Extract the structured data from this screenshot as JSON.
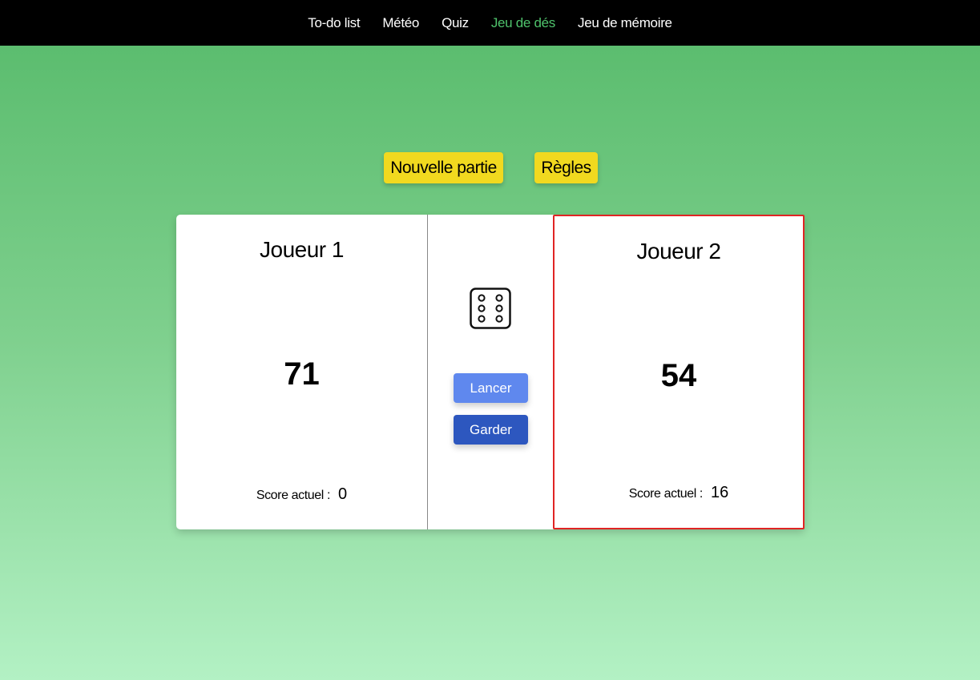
{
  "nav": {
    "items": [
      {
        "label": "To-do list",
        "active": false
      },
      {
        "label": "Météo",
        "active": false
      },
      {
        "label": "Quiz",
        "active": false
      },
      {
        "label": "Jeu de dés",
        "active": true
      },
      {
        "label": "Jeu de mémoire",
        "active": false
      }
    ]
  },
  "controls": {
    "new_game_label": "Nouvelle partie",
    "rules_label": "Règles"
  },
  "game": {
    "roll_label": "Lancer",
    "hold_label": "Garder",
    "dice_face": 6,
    "dice_icon": "dice-six-icon",
    "active_player": 2
  },
  "players": [
    {
      "name": "Joueur 1",
      "score": "71",
      "current_label": "Score actuel :",
      "current_value": "0"
    },
    {
      "name": "Joueur 2",
      "score": "54",
      "current_label": "Score actuel :",
      "current_value": "16"
    }
  ],
  "colors": {
    "nav_background": "#000000",
    "nav_active": "#4fc36c",
    "yellow_button": "#f1d91f",
    "roll_button": "#5f88ee",
    "hold_button": "#2d57bf",
    "active_player_border": "#e02424"
  }
}
